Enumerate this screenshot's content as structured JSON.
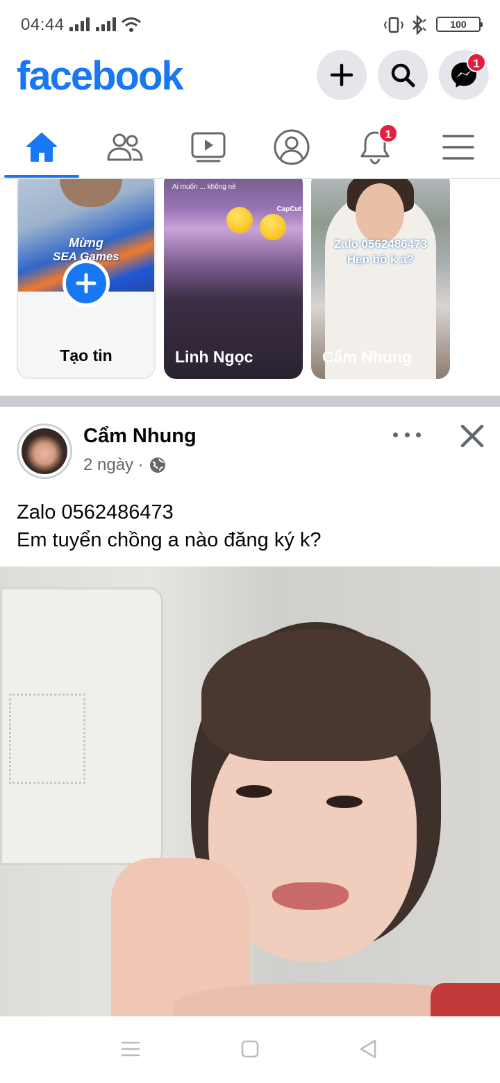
{
  "status": {
    "time": "04:44",
    "battery": "100"
  },
  "header": {
    "logo": "facebook",
    "messenger_badge": "1"
  },
  "nav": {
    "tabs": [
      "home",
      "friends",
      "watch",
      "profile",
      "notifications",
      "menu"
    ],
    "notifications_badge": "1",
    "active_tab": "home"
  },
  "stories": {
    "create_label": "Tạo tin",
    "create_overlay_line1": "Mừng",
    "create_overlay_line2": "SEA Games",
    "items": [
      {
        "name": "Linh Ngọc",
        "caption": "Ai muốn ... không nè",
        "watermark": "CapCut"
      },
      {
        "name": "Cẩm Nhung",
        "caption_line1": "Zalo 0562486473",
        "caption_line2": "Hẹn hò k a?"
      }
    ]
  },
  "post": {
    "author": "Cẩm Nhung",
    "time": "2 ngày ·",
    "privacy": "public",
    "text_line1": "Zalo 0562486473",
    "text_line2": "Em tuyển chồng a nào đăng ký k?"
  },
  "colors": {
    "brand": "#1877f2",
    "badge": "#e41e3f",
    "divider": "#c9ccd1"
  }
}
